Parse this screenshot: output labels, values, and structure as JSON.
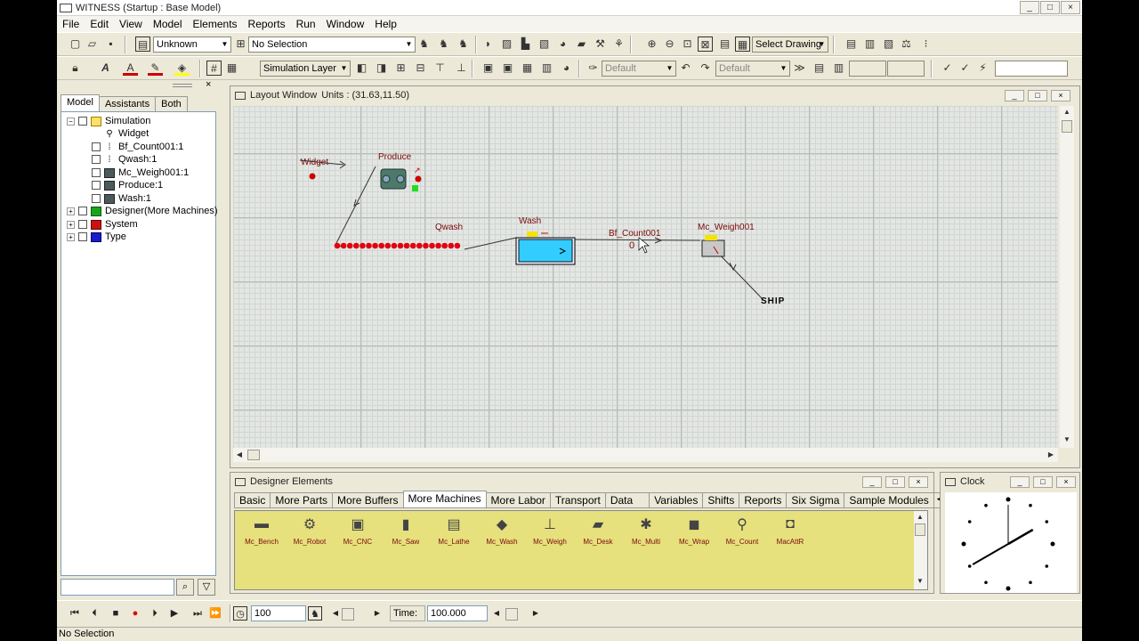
{
  "window": {
    "title": "WITNESS (Startup : Base Model)",
    "minimize": "_",
    "maximize": "□",
    "close": "×"
  },
  "menu": [
    "File",
    "Edit",
    "View",
    "Model",
    "Elements",
    "Reports",
    "Run",
    "Window",
    "Help"
  ],
  "toolbar": {
    "element_type_combo": "Unknown",
    "selection_combo": "No Selection",
    "drawing_combo": "Select Drawing",
    "layer_combo": "Simulation Layer",
    "default_combo_1": "Default",
    "default_combo_2": "Default"
  },
  "explorer": {
    "tabs": [
      "Model",
      "Assistants",
      "Both"
    ],
    "active_tab": "Model",
    "tree": [
      {
        "label": "Simulation",
        "level": 0,
        "expander": "−",
        "icon": "folder-icon"
      },
      {
        "label": "Widget",
        "level": 1,
        "icon": "part-icon"
      },
      {
        "label": "Bf_Count001:1",
        "level": 1,
        "icon": "buffer-icon"
      },
      {
        "label": "Qwash:1",
        "level": 1,
        "icon": "buffer-icon"
      },
      {
        "label": "Mc_Weigh001:1",
        "level": 1,
        "icon": "machine-icon"
      },
      {
        "label": "Produce:1",
        "level": 1,
        "icon": "machine-icon"
      },
      {
        "label": "Wash:1",
        "level": 1,
        "icon": "machine-icon"
      },
      {
        "label": "Designer(More Machines)",
        "level": 0,
        "expander": "+",
        "icon": "designer-icon",
        "color": "#1aa31a"
      },
      {
        "label": "System",
        "level": 0,
        "expander": "+",
        "icon": "system-icon",
        "color": "#cc1111"
      },
      {
        "label": "Type",
        "level": 0,
        "expander": "+",
        "icon": "type-icon",
        "color": "#1a1acc"
      }
    ]
  },
  "layout": {
    "title": "Layout Window",
    "units": "Units : (31.63,11.50)",
    "labels": {
      "widget": "Widget",
      "produce": "Produce",
      "qwash": "Qwash",
      "wash": "Wash",
      "bf_count": "Bf_Count001",
      "bf_count_value": "0",
      "mc_weigh": "Mc_Weigh001",
      "ship": "SHIP"
    },
    "queue_parts": 20
  },
  "designer": {
    "title": "Designer Elements",
    "tabs": [
      "Basic",
      "More Parts",
      "More Buffers",
      "More Machines",
      "More Labor",
      "Transport",
      "Data",
      "Variables",
      "Shifts",
      "Reports",
      "Six Sigma",
      "Sample Modules"
    ],
    "active_tab": "More Machines",
    "items": [
      {
        "label": "Mc_Bench",
        "icon": "bench-icon",
        "glyph": "▬"
      },
      {
        "label": "Mc_Robot",
        "icon": "robot-icon",
        "glyph": "⚙"
      },
      {
        "label": "Mc_CNC",
        "icon": "cnc-icon",
        "glyph": "▣"
      },
      {
        "label": "Mc_Saw",
        "icon": "saw-icon",
        "glyph": "▮"
      },
      {
        "label": "Mc_Lathe",
        "icon": "lathe-icon",
        "glyph": "▤"
      },
      {
        "label": "Mc_Wash",
        "icon": "wash-icon",
        "glyph": "◆"
      },
      {
        "label": "Mc_Weigh",
        "icon": "weigh-icon",
        "glyph": "⊥"
      },
      {
        "label": "Mc_Desk",
        "icon": "desk-icon",
        "glyph": "▰"
      },
      {
        "label": "Mc_Multi",
        "icon": "multi-icon",
        "glyph": "✱"
      },
      {
        "label": "Mc_Wrap",
        "icon": "wrap-icon",
        "glyph": "◼"
      },
      {
        "label": "Mc_Count",
        "icon": "count-icon",
        "glyph": "⚲"
      },
      {
        "label": "MacAttR",
        "icon": "attr-icon",
        "glyph": "◘"
      }
    ]
  },
  "clock": {
    "title": "Clock",
    "hour_hand_deg": 60,
    "minute_hand_deg": 240
  },
  "runbar": {
    "step_value": "100",
    "time_label": "Time:",
    "time_value": "100.000"
  },
  "status": "No Selection"
}
